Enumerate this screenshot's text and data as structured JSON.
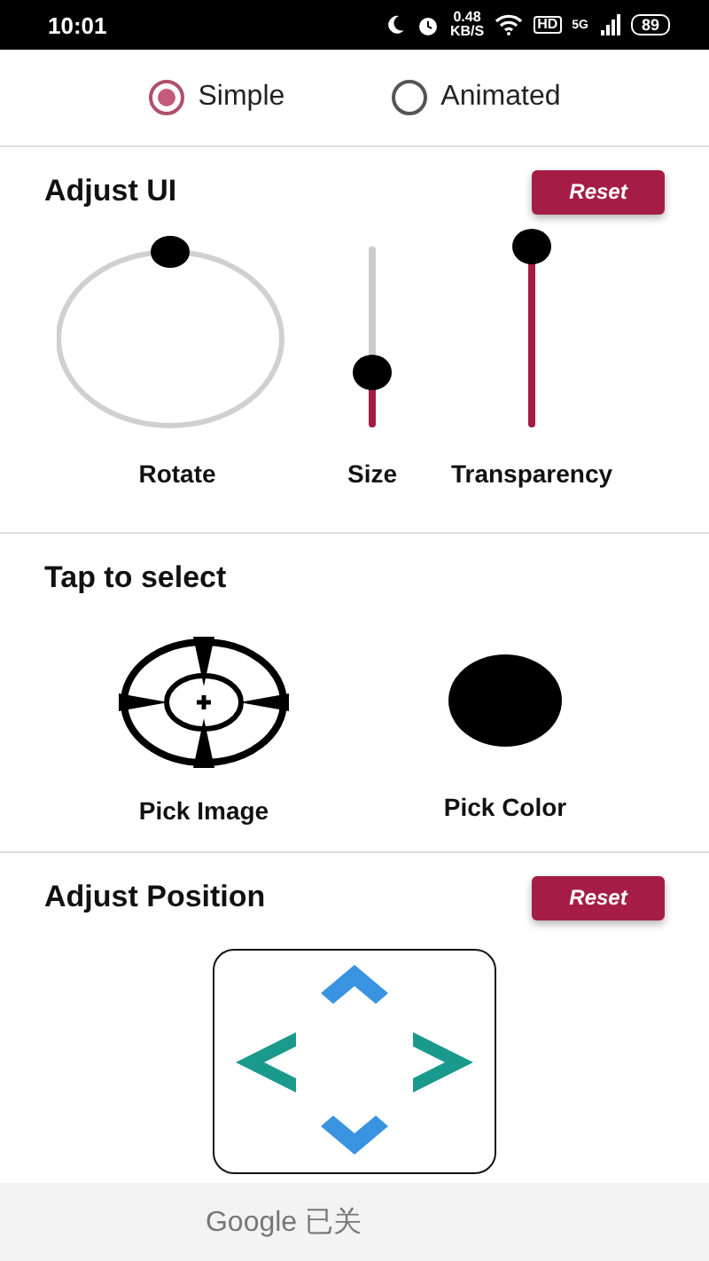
{
  "status_bar": {
    "time": "10:01",
    "net_speed": "0.48",
    "net_unit": "KB/S",
    "hd": "HD",
    "network": "5G",
    "battery": "89"
  },
  "mode": [
    {
      "label": "Simple",
      "selected": true
    },
    {
      "label": "Animated",
      "selected": false
    }
  ],
  "adjust_ui": {
    "title": "Adjust UI",
    "reset": "Reset",
    "controls": [
      {
        "kind": "dial",
        "label": "Rotate"
      },
      {
        "kind": "vslider",
        "label": "Size",
        "level": 0.3
      },
      {
        "kind": "vslider",
        "label": "Transparency",
        "level": 1
      }
    ]
  },
  "tap_to_select": {
    "title": "Tap to select",
    "items": [
      {
        "kind": "target",
        "label": "Pick Image"
      },
      {
        "kind": "swatch",
        "label": "Pick Color",
        "color": "#000000"
      }
    ]
  },
  "adjust_position": {
    "title": "Adjust Position",
    "reset": "Reset"
  },
  "ad_bar": {
    "text": "Google 已关"
  }
}
